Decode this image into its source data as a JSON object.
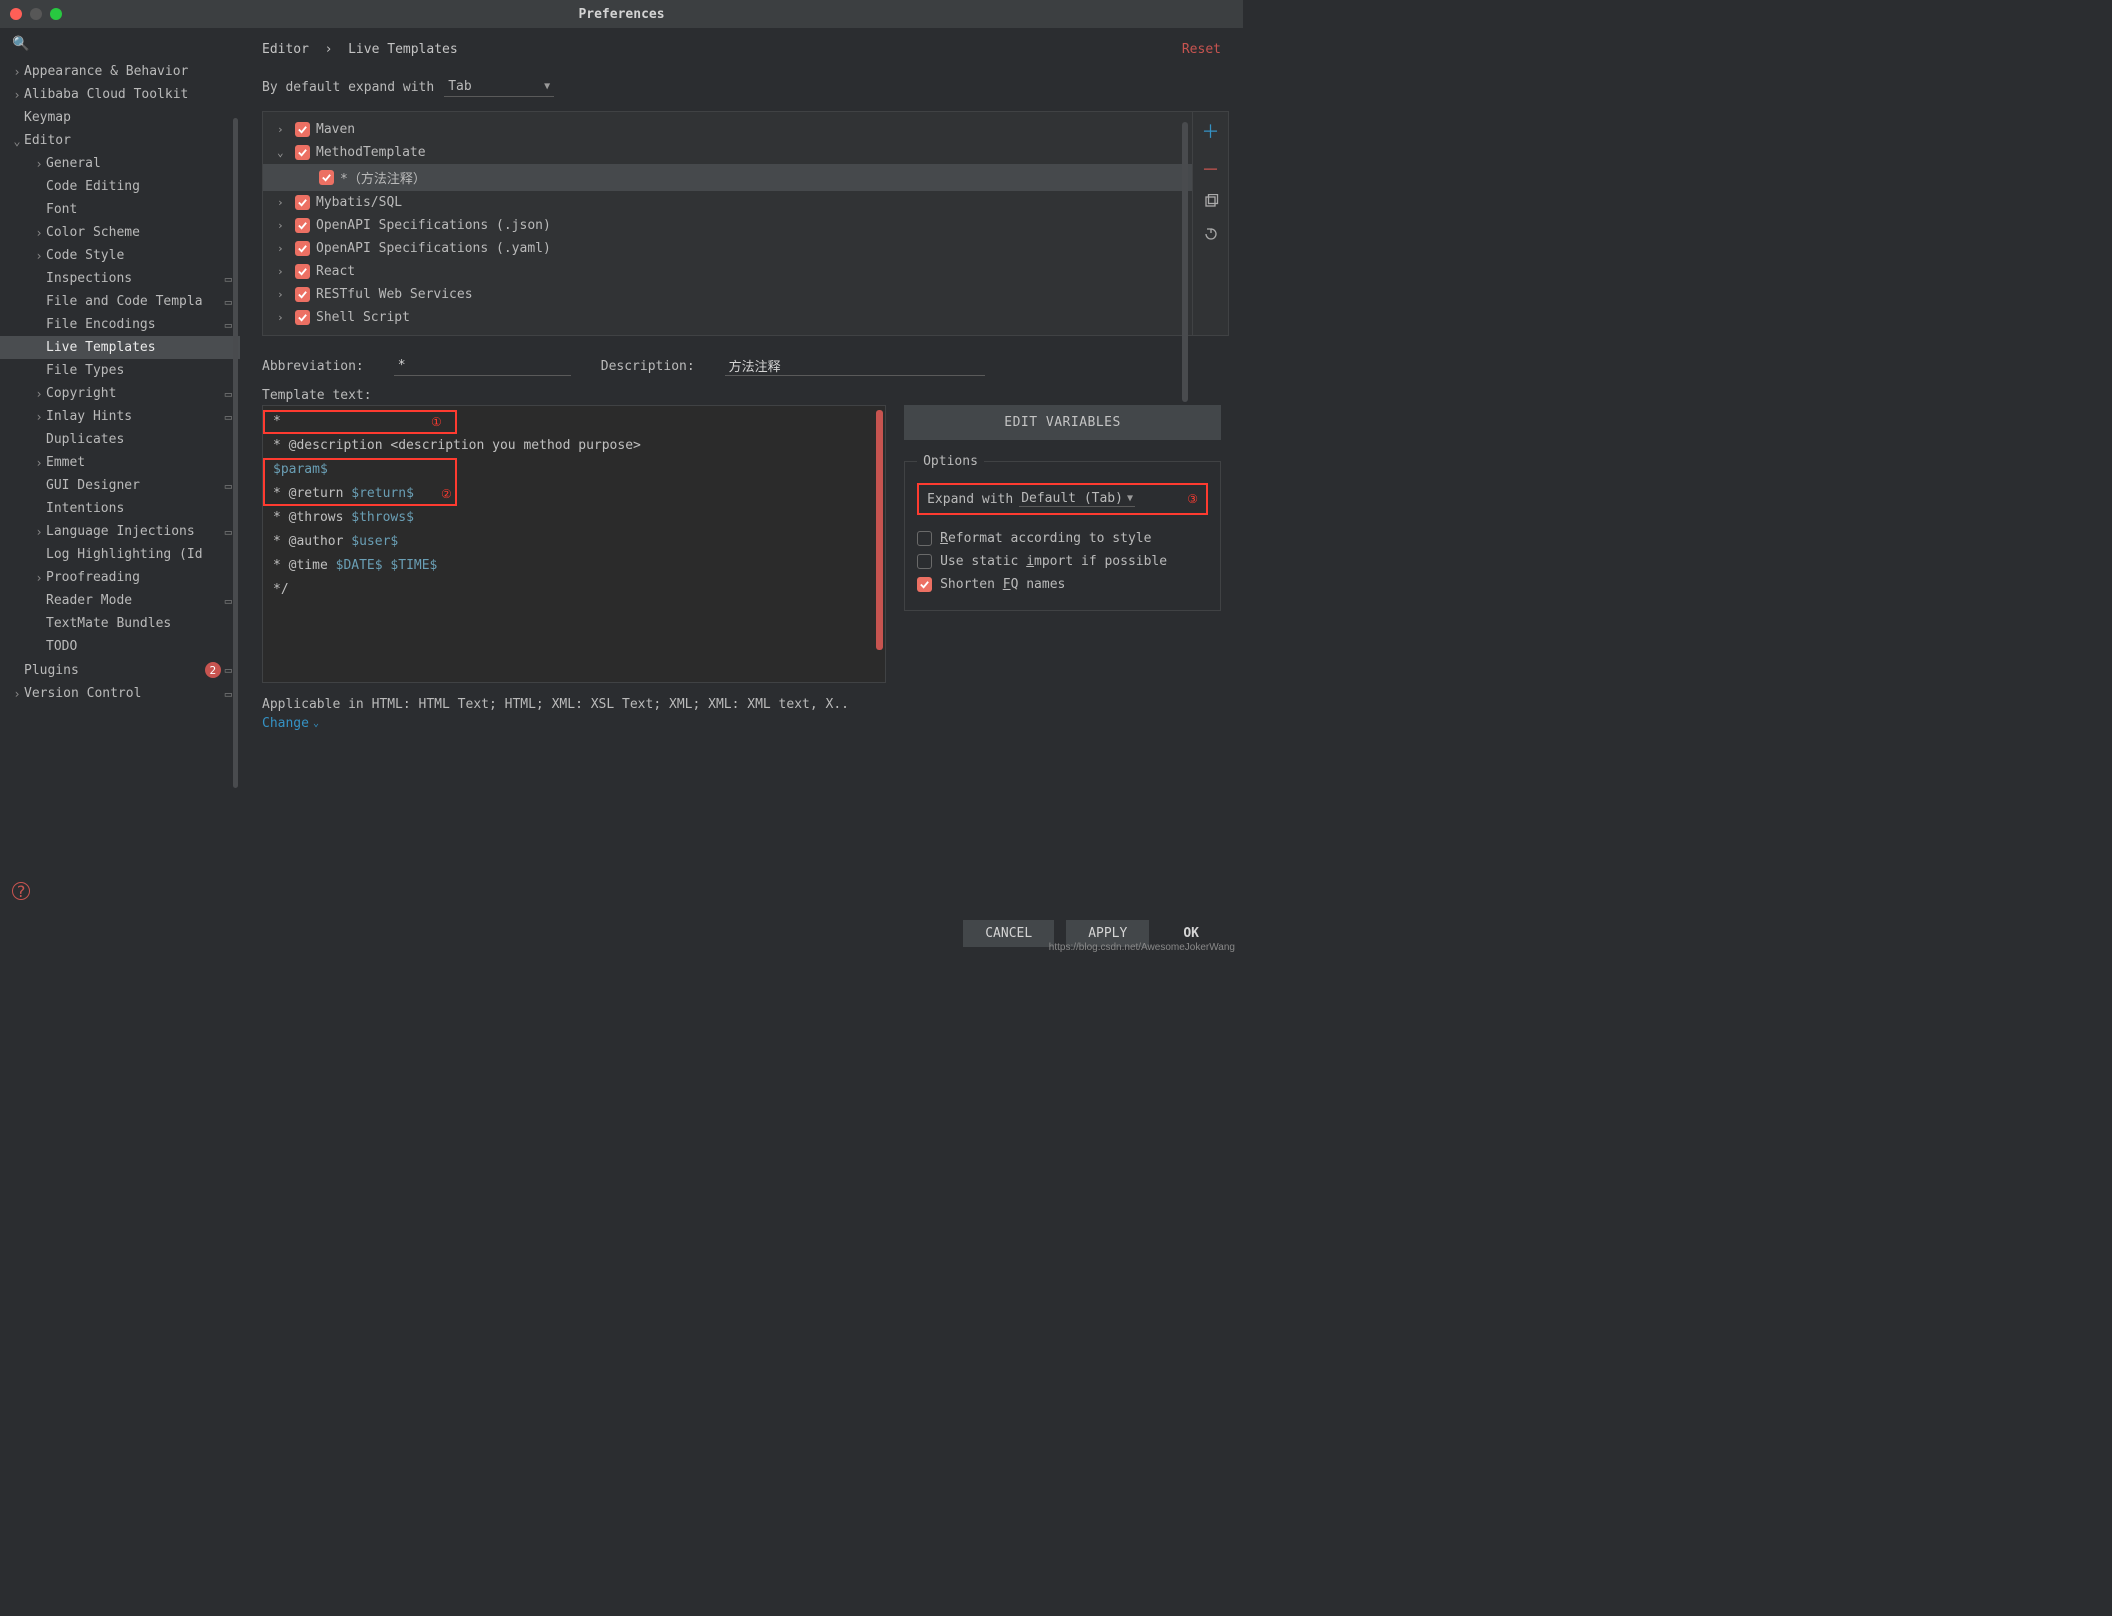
{
  "window": {
    "title": "Preferences"
  },
  "breadcrumb": {
    "root": "Editor",
    "sep": "›",
    "leaf": "Live Templates"
  },
  "reset": "Reset",
  "defaultExpand": {
    "label": "By default expand with",
    "value": "Tab"
  },
  "sidebar": {
    "items": [
      {
        "label": "Appearance & Behavior",
        "arrow": "›",
        "indent": 0
      },
      {
        "label": "Alibaba Cloud Toolkit",
        "arrow": "›",
        "indent": 0
      },
      {
        "label": "Keymap",
        "arrow": "",
        "indent": 0
      },
      {
        "label": "Editor",
        "arrow": "⌄",
        "indent": 0
      },
      {
        "label": "General",
        "arrow": "›",
        "indent": 1
      },
      {
        "label": "Code Editing",
        "arrow": "",
        "indent": 1
      },
      {
        "label": "Font",
        "arrow": "",
        "indent": 1
      },
      {
        "label": "Color Scheme",
        "arrow": "›",
        "indent": 1
      },
      {
        "label": "Code Style",
        "arrow": "›",
        "indent": 1
      },
      {
        "label": "Inspections",
        "arrow": "",
        "indent": 1,
        "setting": true
      },
      {
        "label": "File and Code Templa",
        "arrow": "",
        "indent": 1,
        "setting": true
      },
      {
        "label": "File Encodings",
        "arrow": "",
        "indent": 1,
        "setting": true
      },
      {
        "label": "Live Templates",
        "arrow": "",
        "indent": 1,
        "sel": true
      },
      {
        "label": "File Types",
        "arrow": "",
        "indent": 1
      },
      {
        "label": "Copyright",
        "arrow": "›",
        "indent": 1,
        "setting": true
      },
      {
        "label": "Inlay Hints",
        "arrow": "›",
        "indent": 1,
        "setting": true
      },
      {
        "label": "Duplicates",
        "arrow": "",
        "indent": 1
      },
      {
        "label": "Emmet",
        "arrow": "›",
        "indent": 1
      },
      {
        "label": "GUI Designer",
        "arrow": "",
        "indent": 1,
        "setting": true
      },
      {
        "label": "Intentions",
        "arrow": "",
        "indent": 1
      },
      {
        "label": "Language Injections",
        "arrow": "›",
        "indent": 1,
        "setting": true
      },
      {
        "label": "Log Highlighting (Id",
        "arrow": "",
        "indent": 1
      },
      {
        "label": "Proofreading",
        "arrow": "›",
        "indent": 1
      },
      {
        "label": "Reader Mode",
        "arrow": "",
        "indent": 1,
        "setting": true
      },
      {
        "label": "TextMate Bundles",
        "arrow": "",
        "indent": 1
      },
      {
        "label": "TODO",
        "arrow": "",
        "indent": 1
      },
      {
        "label": "Plugins",
        "arrow": "",
        "indent": 0,
        "badge": "2",
        "setting": true
      },
      {
        "label": "Version Control",
        "arrow": "›",
        "indent": 0,
        "setting": true
      }
    ]
  },
  "templateTree": [
    {
      "label": "Maven",
      "chev": "›",
      "indent": 0
    },
    {
      "label": "MethodTemplate",
      "chev": "⌄",
      "indent": 0
    },
    {
      "label": "*（方法注释）",
      "chev": "",
      "indent": 1,
      "sel": true
    },
    {
      "label": "Mybatis/SQL",
      "chev": "›",
      "indent": 0
    },
    {
      "label": "OpenAPI Specifications (.json)",
      "chev": "›",
      "indent": 0
    },
    {
      "label": "OpenAPI Specifications (.yaml)",
      "chev": "›",
      "indent": 0
    },
    {
      "label": "React",
      "chev": "›",
      "indent": 0
    },
    {
      "label": "RESTful Web Services",
      "chev": "›",
      "indent": 0
    },
    {
      "label": "Shell Script",
      "chev": "›",
      "indent": 0
    }
  ],
  "fields": {
    "abbr_label": "Abbreviation:",
    "abbr_value": "*",
    "desc_label": "Description:",
    "desc_value": "方法注释",
    "template_text_label": "Template text:"
  },
  "templateText": {
    "l1": "*",
    "l2a": " * @description ",
    "l2b": "<description you method purpose>",
    "l3": "$param$",
    "l4a": " * @return ",
    "l4b": "$return$",
    "l5a": " * @throws ",
    "l5b": "$throws$",
    "l6a": " * @author ",
    "l6b": "$user$",
    "l7a": " * @time ",
    "l7b": "$DATE$",
    "l7c": " ",
    "l7d": "$TIME$",
    "l8": " */",
    "num1": "①",
    "num2": "②"
  },
  "editVars": "EDIT VARIABLES",
  "options": {
    "legend": "Options",
    "expand_label": "Expand with",
    "expand_value": "Default (Tab)",
    "num3": "③",
    "reformat": "Reformat according to style",
    "reformat_u": "R",
    "static_import": "Use static import if possible",
    "static_u": "i",
    "shorten_fq": "Shorten FQ names",
    "shorten_u": "F"
  },
  "applicable": "Applicable in HTML: HTML Text; HTML; XML: XSL Text; XML; XML: XML text, X..",
  "change": "Change",
  "footer": {
    "cancel": "CANCEL",
    "apply": "APPLY",
    "ok": "OK"
  },
  "watermark": "https://blog.csdn.net/AwesomeJokerWang"
}
